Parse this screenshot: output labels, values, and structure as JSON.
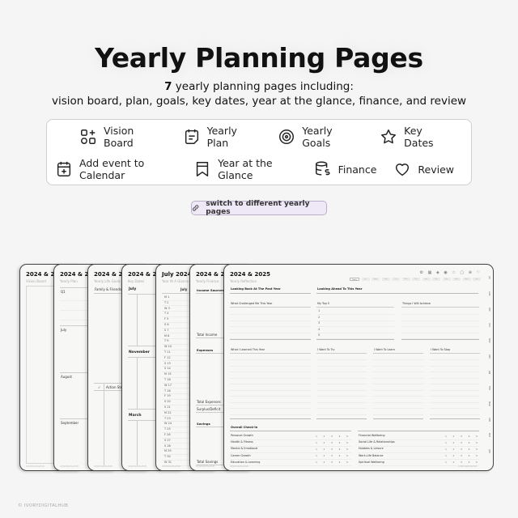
{
  "header": {
    "title": "Yearly Planning Pages",
    "subtitle_count": "7",
    "subtitle_line1_rest": " yearly planning pages including:",
    "subtitle_line2": "vision board, plan, goals, key dates, year at the glance, finance, and review"
  },
  "features": {
    "row1": [
      {
        "label": "Vision Board",
        "icon": "grid-plus-icon"
      },
      {
        "label": "Yearly Plan",
        "icon": "calendar-note-icon"
      },
      {
        "label": "Yearly Goals",
        "icon": "target-icon"
      },
      {
        "label": "Key Dates",
        "icon": "star-icon"
      }
    ],
    "row2": [
      {
        "label": "Add event to Calendar",
        "icon": "calendar-plus-icon"
      },
      {
        "label": "Year at the Glance",
        "icon": "bookmark-icon"
      },
      {
        "label": "Finance",
        "icon": "coins-dollar-icon"
      },
      {
        "label": "Review",
        "icon": "heart-icon"
      }
    ]
  },
  "switch_pill": {
    "label": "switch to different yearly pages",
    "icon": "link-icon"
  },
  "pages": [
    {
      "title": "2024 & 2025",
      "subtitle": "Vision Board",
      "footer": "IVORYDIGITALHUB"
    },
    {
      "title": "2024 & 2025",
      "subtitle": "Yearly Plan",
      "footer": "IVORYDIGITALHUB",
      "sections": [
        "Q1",
        "July",
        "August",
        "September"
      ]
    },
    {
      "title": "2024 & 2025",
      "subtitle": "Yearly Life Goals",
      "footer": "IVORYDIGITALHUB",
      "sections": [
        "Family & Friends"
      ],
      "action_check": "✓",
      "action_label": "Action Steps"
    },
    {
      "title": "2024 & 2025",
      "subtitle": "Key Dates",
      "footer": "IVORYDIGITALHUB",
      "sections": [
        "July",
        "November",
        "March"
      ]
    },
    {
      "title": "July 2024 –",
      "subtitle": "Year At A Glance",
      "footer": "IVORYDIGITALHUB",
      "month": "July",
      "days": [
        "M 1",
        "T 2",
        "W 3",
        "T 4",
        "F 5",
        "S 6",
        "S 7",
        "M 8",
        "T 9",
        "W 10",
        "T 11",
        "F 12",
        "S 13",
        "S 14",
        "M 15",
        "T 16",
        "W 17",
        "T 18",
        "F 19",
        "S 20",
        "S 21",
        "M 22",
        "T 23",
        "W 24",
        "T 25",
        "F 26",
        "S 27",
        "S 28",
        "M 29",
        "T 30",
        "W 31"
      ]
    },
    {
      "title": "2024 & 2025",
      "subtitle": "Yearly Finance",
      "footer": "IVORYDIGITALHUB",
      "labels": [
        "Income Sources",
        "Total Income",
        "Expenses",
        "Total Expenses",
        "Surplus/Deficit",
        "Savings",
        "Total Savings"
      ]
    },
    {
      "title": "2024 & 2025",
      "subtitle": "Yearly Reflection",
      "footer_left": "IVORYDIGITALHUB",
      "footer_right": "IVORYDIGITALHUB",
      "top_icons": "⚙ ▦ ◈ ◉ ☆ ▢ ⊕ ♡",
      "tabs": [
        "Yearly",
        "Jul",
        "Aug",
        "Sep",
        "Oct",
        "Nov",
        "Dec",
        "Jan",
        "Feb",
        "Mar",
        "Apr",
        "May",
        "Jun"
      ],
      "looking_back": "Looking Back At The Past Year",
      "looking_ahead": "Looking Ahead To This Year",
      "challenged": "What Challenged Me This Year",
      "top5": "My Top 5",
      "top5_items": [
        "1",
        "2",
        "3",
        "4",
        "5"
      ],
      "achieve": "Things I Will Achieve",
      "learned": "What I Learned This Year",
      "try": "I Want To Try",
      "learn": "I Want To Learn",
      "stop": "I Want To Stop",
      "checkin_title": "Overall Check-In",
      "checkin_left": [
        "Personal Growth",
        "Health & Fitness",
        "Mental & Emotional",
        "Career Growth",
        "Education & Learning"
      ],
      "checkin_right": [
        "Financial Wellbeing",
        "Social Life & Relationships",
        "Hobbies & Leisure",
        "Work-Life Balance",
        "Spiritual Wellbeing"
      ],
      "scale": [
        "1",
        "2",
        "3",
        "4",
        "5"
      ],
      "side_tabs": [
        "JUL",
        "AUG",
        "SEP",
        "OCT",
        "NOV",
        "DEC",
        "JAN",
        "FEB",
        "MAR",
        "APR",
        "MAY",
        "JUN"
      ]
    }
  ],
  "copyright": "© IVORYDIGITALHUB"
}
